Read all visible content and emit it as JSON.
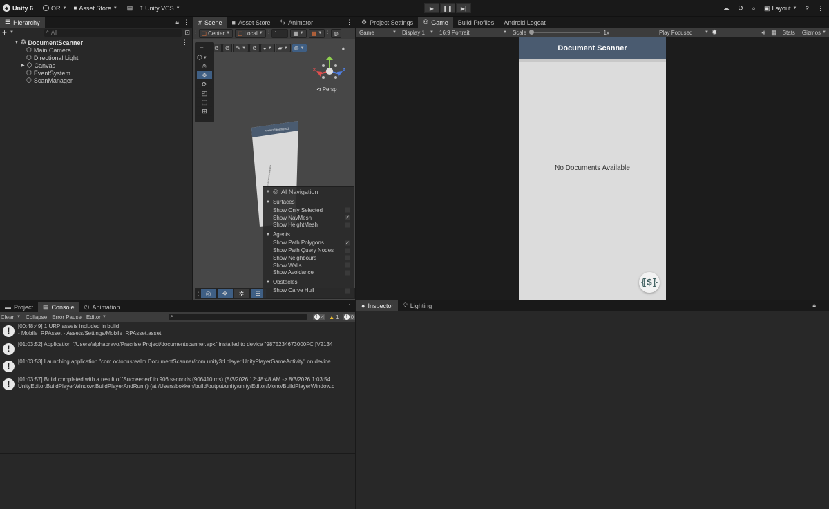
{
  "topbar": {
    "app_name": "Unity 6",
    "account": "OR",
    "asset_store": "Asset Store",
    "vcs": "Unity VCS",
    "layout": "Layout"
  },
  "hierarchy": {
    "tab": "Hierarchy",
    "search_placeholder": "All",
    "scene": "DocumentScanner",
    "items": [
      {
        "label": "Main Camera"
      },
      {
        "label": "Directional Light"
      },
      {
        "label": "Canvas"
      },
      {
        "label": "EventSystem"
      },
      {
        "label": "ScanManager"
      }
    ]
  },
  "scene": {
    "tabs": [
      "Scene",
      "Asset Store",
      "Animator"
    ],
    "pivot": "Center",
    "space": "Local",
    "grid_value": "1",
    "persp_label": "Persp",
    "canvas_text": "Document Scanner",
    "canvas_body_text": "No Documents Available",
    "gizmo_axes": {
      "x": "x",
      "z": "z"
    }
  },
  "ai_navigation": {
    "title": "AI Navigation",
    "sections": [
      {
        "name": "Surfaces",
        "items": [
          {
            "label": "Show Only Selected",
            "checked": false
          },
          {
            "label": "Show NavMesh",
            "checked": true
          },
          {
            "label": "Show HeightMesh",
            "checked": false
          }
        ]
      },
      {
        "name": "Agents",
        "items": [
          {
            "label": "Show Path Polygons",
            "checked": true
          },
          {
            "label": "Show Path Query Nodes",
            "checked": false
          },
          {
            "label": "Show Neighbours",
            "checked": false
          },
          {
            "label": "Show Walls",
            "checked": false
          },
          {
            "label": "Show Avoidance",
            "checked": false
          }
        ]
      },
      {
        "name": "Obstacles",
        "items": [
          {
            "label": "Show Carve Hull",
            "checked": false
          }
        ]
      }
    ]
  },
  "game": {
    "tabs": [
      "Project Settings",
      "Game",
      "Build Profiles",
      "Android Logcat"
    ],
    "display_mode": "Game",
    "display": "Display 1",
    "aspect": "16:9 Portrait",
    "scale_label": "Scale",
    "scale_value": "1x",
    "play_mode": "Play Focused",
    "stats": "Stats",
    "gizmos": "Gizmos",
    "app_title": "Document Scanner",
    "empty_text": "No Documents Available",
    "colors": {
      "header": "#4a5b70",
      "body": "#dcdcdc"
    }
  },
  "console": {
    "tabs": [
      "Project",
      "Console",
      "Animation"
    ],
    "clear": "Clear",
    "collapse": "Collapse",
    "error_pause": "Error Pause",
    "editor": "Editor",
    "counts": {
      "info": "4",
      "warn": "1",
      "error": "0"
    },
    "logs": [
      {
        "line1": "[00:48:49] 1 URP assets included in build",
        "line2": "- Mobile_RPAsset - Assets/Settings/Mobile_RPAsset.asset"
      },
      {
        "line1": "[01:03:52] Application \"/Users/alphabravo/Pracrise Project/documentscanner.apk\" installed to device \"9875234673000FC [V2134",
        "line2": ""
      },
      {
        "line1": "[01:03:53] Launching application \"com.octopusrealm.DocumentScanner/com.unity3d.player.UnityPlayerGameActivity\" on device",
        "line2": ""
      },
      {
        "line1": "[01:03:57] Build completed with a result of 'Succeeded' in 906 seconds (906410 ms) (8/3/2026 12:48:48 AM -> 8/3/2026 1:03:54",
        "line2": "UnityEditor.BuildPlayerWindow:BuildPlayerAndRun () (at /Users/bokken/build/output/unity/unity/Editor/Mono/BuildPlayerWindow.c"
      }
    ]
  },
  "inspector": {
    "tabs": [
      "Inspector",
      "Lighting"
    ]
  }
}
